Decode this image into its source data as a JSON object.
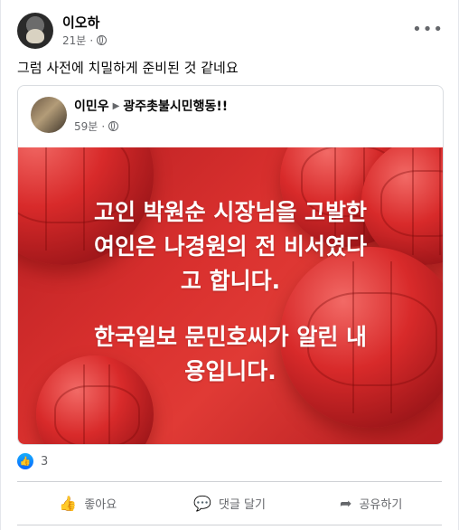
{
  "post": {
    "author": "이오하",
    "time": "21분",
    "text": "그럼 사전에 치밀하게 준비된 것 같네요"
  },
  "shared": {
    "author": "이민우",
    "group": "광주촛불시민행동!!",
    "time": "59분",
    "image_lines": [
      "고인 박원순 시장님을 고발한",
      "여인은 나경원의 전 비서였다",
      "고 합니다.",
      "한국일보 문민호씨가 알린 내",
      "용입니다."
    ]
  },
  "reactions": {
    "count": "3"
  },
  "actions": {
    "like": "좋아요",
    "comment": "댓글 달기",
    "share": "공유하기"
  },
  "icons": {
    "privacy": "globe-icon",
    "more": "more-options-icon",
    "like_badge": "thumbs-up-icon"
  },
  "colors": {
    "image_red": "#d9302e",
    "like_blue": "#0866ff",
    "meta_gray": "#65676b"
  }
}
